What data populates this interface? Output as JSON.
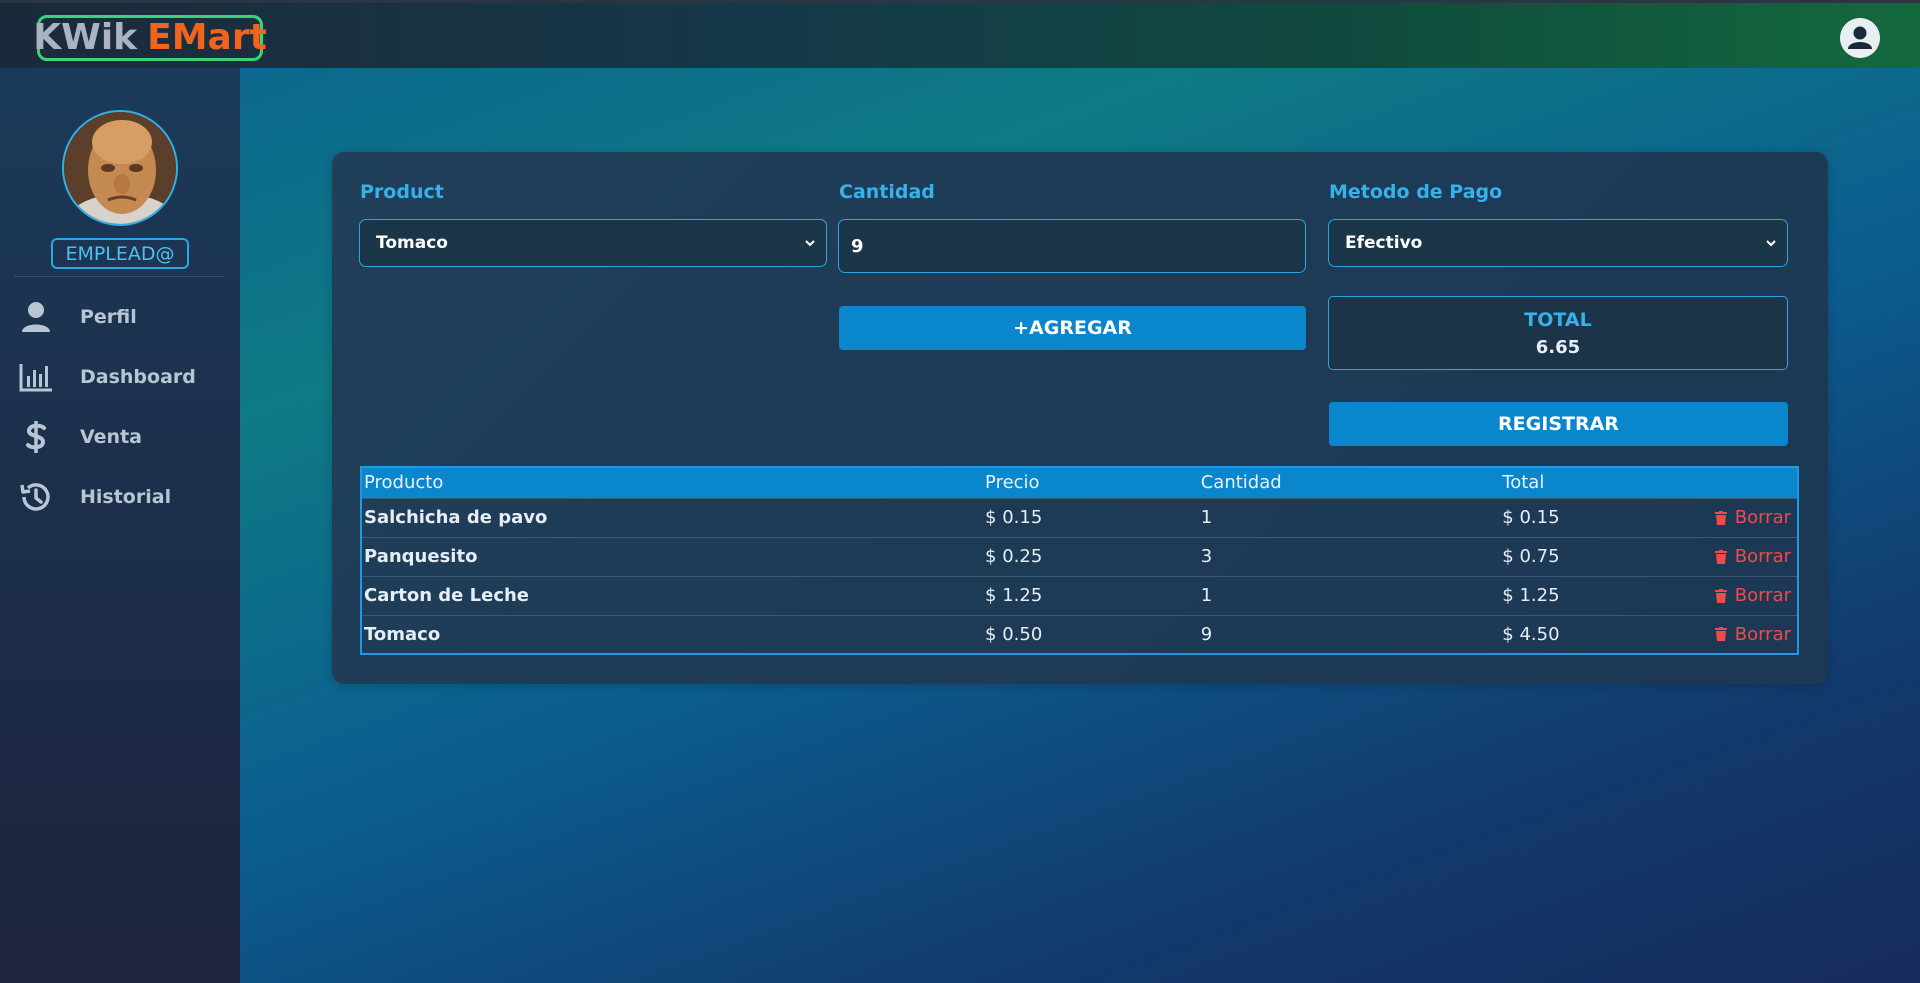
{
  "brand": {
    "part1": "KWik",
    "part2": "EMart",
    "accent": "#f0641e"
  },
  "sidebar": {
    "role": "EMPLEAD@",
    "items": [
      {
        "label": "Perfil",
        "icon": "user-icon"
      },
      {
        "label": "Dashboard",
        "icon": "bar-chart-icon"
      },
      {
        "label": "Venta",
        "icon": "dollar-icon"
      },
      {
        "label": "Historial",
        "icon": "history-icon"
      }
    ]
  },
  "form": {
    "product_label": "Product",
    "product_value": "Tomaco",
    "qty_label": "Cantidad",
    "qty_value": "9",
    "payment_label": "Metodo de Pago",
    "payment_value": "Efectivo",
    "add_label": "+AGREGAR",
    "total_label": "TOTAL",
    "total_value": "6.65",
    "register_label": "REGISTRAR"
  },
  "table": {
    "headers": [
      "Producto",
      "Precio",
      "Cantidad",
      "Total"
    ],
    "delete_label": "Borrar",
    "rows": [
      {
        "producto": "Salchicha de pavo",
        "precio": "$ 0.15",
        "cantidad": "1",
        "total": "$ 0.15"
      },
      {
        "producto": "Panquesito",
        "precio": "$ 0.25",
        "cantidad": "3",
        "total": "$ 0.75"
      },
      {
        "producto": "Carton de Leche",
        "precio": "$ 1.25",
        "cantidad": "1",
        "total": "$ 1.25"
      },
      {
        "producto": "Tomaco",
        "precio": "$ 0.50",
        "cantidad": "9",
        "total": "$ 4.50"
      }
    ]
  },
  "colors": {
    "primary": "#0a86cc",
    "label": "#35b2ea",
    "danger": "#f04a4a",
    "logo_border": "#3ad37b"
  }
}
